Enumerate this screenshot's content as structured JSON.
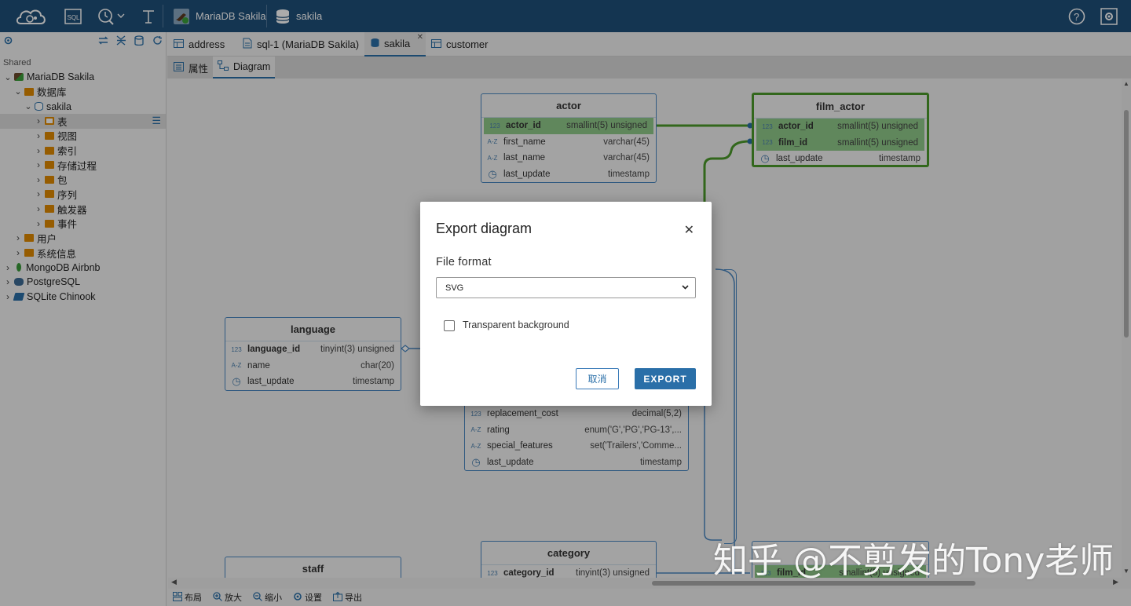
{
  "topbar": {
    "connection": "MariaDB Sakila",
    "database": "sakila"
  },
  "sidebar": {
    "shared_label": "Shared",
    "tree": [
      {
        "label": "MariaDB Sakila",
        "depth": 0,
        "icon": "mariadb-icon"
      },
      {
        "label": "数据库",
        "depth": 1,
        "icon": "folder-icon"
      },
      {
        "label": "sakila",
        "depth": 2,
        "icon": "database-icon"
      },
      {
        "label": "表",
        "depth": 3,
        "icon": "table-folder-icon",
        "selected": true
      },
      {
        "label": "视图",
        "depth": 3,
        "icon": "view-folder-icon"
      },
      {
        "label": "索引",
        "depth": 3,
        "icon": "folder-icon"
      },
      {
        "label": "存储过程",
        "depth": 3,
        "icon": "folder-icon"
      },
      {
        "label": "包",
        "depth": 3,
        "icon": "folder-icon"
      },
      {
        "label": "序列",
        "depth": 3,
        "icon": "folder-icon"
      },
      {
        "label": "触发器",
        "depth": 3,
        "icon": "folder-icon"
      },
      {
        "label": "事件",
        "depth": 3,
        "icon": "folder-icon"
      },
      {
        "label": "用户",
        "depth": 1,
        "icon": "users-folder-icon"
      },
      {
        "label": "系统信息",
        "depth": 1,
        "icon": "info-folder-icon"
      },
      {
        "label": "MongoDB Airbnb",
        "depth": 0,
        "icon": "mongodb-icon"
      },
      {
        "label": "PostgreSQL",
        "depth": 0,
        "icon": "postgresql-icon"
      },
      {
        "label": "SQLite Chinook",
        "depth": 0,
        "icon": "sqlite-icon"
      }
    ]
  },
  "tabs": [
    {
      "label": "address",
      "icon": "table-icon"
    },
    {
      "label": "sql-1 (MariaDB Sakila)",
      "icon": "sql-file-icon"
    },
    {
      "label": "sakila",
      "icon": "database-icon",
      "active": true
    },
    {
      "label": "customer",
      "icon": "table-icon"
    }
  ],
  "subtabs": {
    "properties": "属性",
    "diagram": "Diagram"
  },
  "entities": {
    "actor": {
      "title": "actor",
      "cols": [
        {
          "t": "123",
          "n": "actor_id",
          "ty": "smallint(5) unsigned",
          "k": true
        },
        {
          "t": "A-Z",
          "n": "first_name",
          "ty": "varchar(45)"
        },
        {
          "t": "A-Z",
          "n": "last_name",
          "ty": "varchar(45)"
        },
        {
          "t": "◷",
          "n": "last_update",
          "ty": "timestamp"
        }
      ]
    },
    "film_actor": {
      "title": "film_actor",
      "cols": [
        {
          "t": "123",
          "n": "actor_id",
          "ty": "smallint(5) unsigned",
          "k": true
        },
        {
          "t": "123",
          "n": "film_id",
          "ty": "smallint(5) unsigned",
          "k": true
        },
        {
          "t": "◷",
          "n": "last_update",
          "ty": "timestamp"
        }
      ]
    },
    "language": {
      "title": "language",
      "cols": [
        {
          "t": "123",
          "n": "language_id",
          "ty": "tinyint(3) unsigned",
          "bold": true
        },
        {
          "t": "A-Z",
          "n": "name",
          "ty": "char(20)"
        },
        {
          "t": "◷",
          "n": "last_update",
          "ty": "timestamp"
        }
      ]
    },
    "film": {
      "cols": [
        {
          "t": "123",
          "n": "replacement_cost",
          "ty": "decimal(5,2)"
        },
        {
          "t": "A-Z",
          "n": "rating",
          "ty": "enum('G','PG','PG-13',..."
        },
        {
          "t": "A-Z",
          "n": "special_features",
          "ty": "set('Trailers','Comme..."
        },
        {
          "t": "◷",
          "n": "last_update",
          "ty": "timestamp"
        }
      ]
    },
    "category": {
      "title": "category",
      "cols": [
        {
          "t": "123",
          "n": "category_id",
          "ty": "tinyint(3) unsigned",
          "bold": true
        }
      ]
    },
    "film_category": {
      "cols": [
        {
          "t": "123",
          "n": "film_id",
          "ty": "smallint(5) unsigned",
          "k": true
        }
      ]
    },
    "staff": {
      "title": "staff"
    }
  },
  "bottombar": {
    "layout": "布局",
    "zoom_in": "放大",
    "zoom_out": "缩小",
    "settings": "设置",
    "export": "导出"
  },
  "dialog": {
    "title": "Export diagram",
    "format_label": "File format",
    "format_value": "SVG",
    "transparent_label": "Transparent background",
    "transparent_checked": false,
    "cancel": "取消",
    "export": "EXPORT"
  },
  "watermark": "知乎 @不剪发的Tony老师",
  "colors": {
    "topbar": "#1e4f7a",
    "accent": "#2a6fa8",
    "key_row": "#8fc98a",
    "selected_entity": "#4b9a2a"
  }
}
